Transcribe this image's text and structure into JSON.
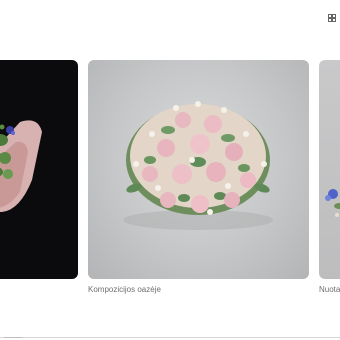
{
  "header": {
    "icon": "grid-icon"
  },
  "carousel": {
    "cards": [
      {
        "caption": "",
        "image": "violet-bouquet-on-black"
      },
      {
        "caption": "Kompozicijos oazėje",
        "image": "pink-lisianthus-dome-arrangement"
      },
      {
        "caption": "Nuota",
        "image": "blue-flower-arrangement"
      }
    ]
  },
  "colors": {
    "background": "#ffffff",
    "caption": "#6f6f6f",
    "dark_card": "#0b0b0d",
    "light_card": "#c6c7c8"
  }
}
